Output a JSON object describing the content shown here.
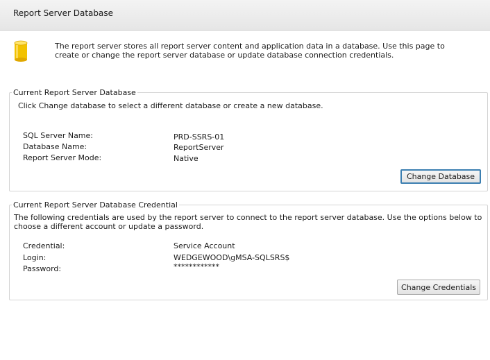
{
  "header": {
    "title": "Report Server Database"
  },
  "intro": {
    "icon": "database-icon",
    "text": "The report server stores all report server content and application data in a database. Use this page to create or change the report server database or update database connection credentials."
  },
  "current_database": {
    "legend": "Current Report Server Database",
    "instruction": "Click Change database to select a different database or create a new database.",
    "fields": [
      {
        "label": "SQL Server Name:",
        "value": "PRD-SSRS-01"
      },
      {
        "label": "Database Name:",
        "value": "ReportServer"
      },
      {
        "label": "Report Server Mode:",
        "value": "Native"
      }
    ],
    "button_label": "Change Database"
  },
  "credential": {
    "legend": "Current Report Server Database Credential",
    "description": "The following credentials are used by the report server to connect to the report server database.  Use the options below to choose a different account or update a password.",
    "fields": [
      {
        "label": "Credential:",
        "value": "Service Account"
      },
      {
        "label": "Login:",
        "value": "WEDGEWOOD\\gMSA-SQLSRS$"
      },
      {
        "label": "Password:",
        "value": "************"
      }
    ],
    "button_label": "Change Credentials"
  },
  "colors": {
    "icon_fill": "#f5c400",
    "focus_border": "#3c7fb1"
  }
}
